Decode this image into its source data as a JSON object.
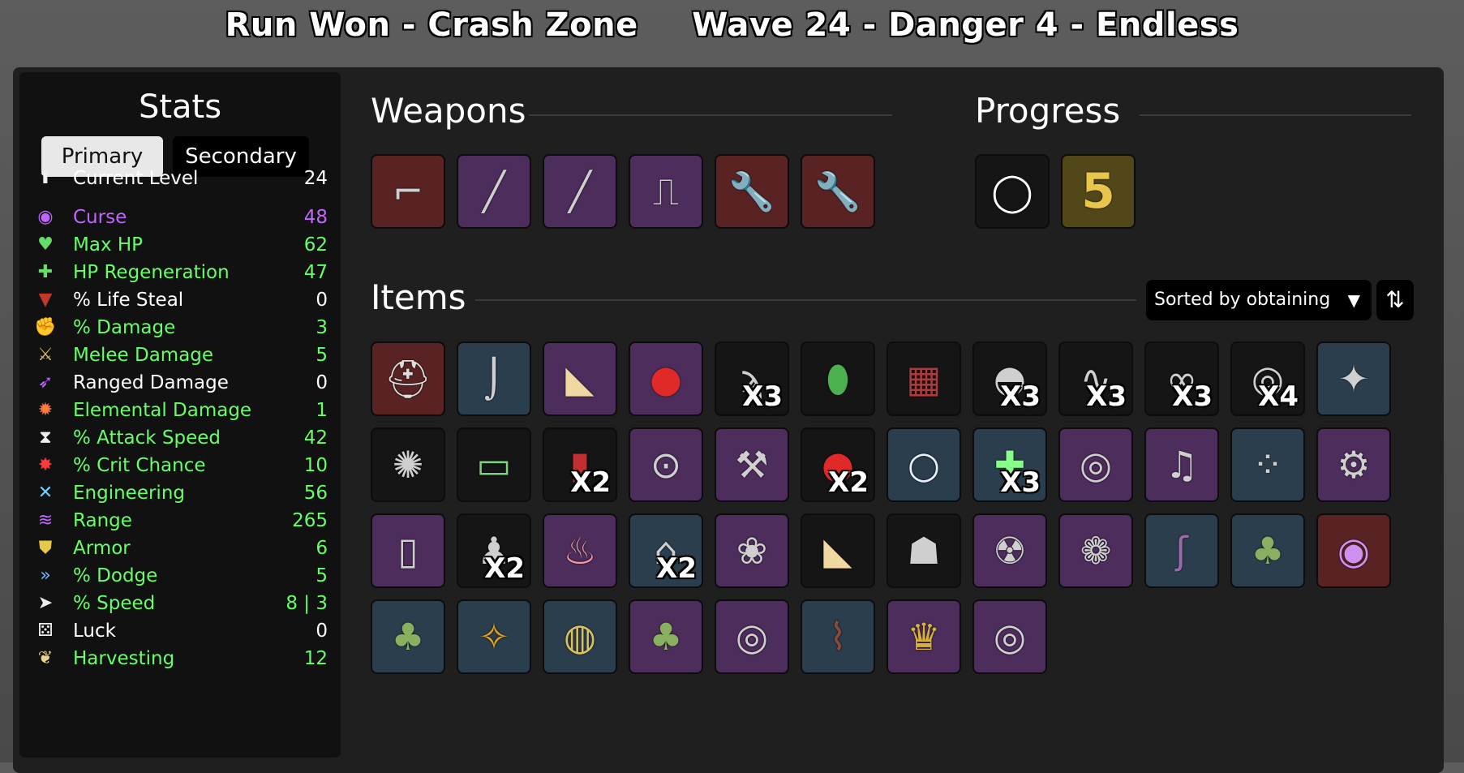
{
  "header": {
    "run": "Run Won - Crash Zone",
    "wave": "Wave 24 - Danger 4 - Endless"
  },
  "stats": {
    "title": "Stats",
    "tabs": {
      "primary": "Primary",
      "secondary": "Secondary"
    },
    "rows": [
      {
        "label": "Current Level",
        "value": "24",
        "color": "#ffffff",
        "icon": "level-up-icon"
      },
      {
        "label": "Curse",
        "value": "48",
        "color": "#c065ff",
        "icon": "curse-eye-icon"
      },
      {
        "label": "Max HP",
        "value": "62",
        "color": "#66ff66",
        "icon": "heart-icon"
      },
      {
        "label": "HP Regeneration",
        "value": "47",
        "color": "#66ff66",
        "icon": "heart-plus-icon"
      },
      {
        "label": "% Life Steal",
        "value": "0",
        "color": "#ffffff",
        "icon": "fangs-icon"
      },
      {
        "label": "% Damage",
        "value": "3",
        "color": "#66ff66",
        "icon": "muscle-icon"
      },
      {
        "label": "Melee Damage",
        "value": "5",
        "color": "#66ff66",
        "icon": "sword-icon"
      },
      {
        "label": "Ranged Damage",
        "value": "0",
        "color": "#ffffff",
        "icon": "bow-icon"
      },
      {
        "label": "Elemental Damage",
        "value": "1",
        "color": "#66ff66",
        "icon": "flame-icon"
      },
      {
        "label": "% Attack Speed",
        "value": "42",
        "color": "#66ff66",
        "icon": "hourglass-icon"
      },
      {
        "label": "% Crit Chance",
        "value": "10",
        "color": "#66ff66",
        "icon": "crit-burst-icon"
      },
      {
        "label": "Engineering",
        "value": "56",
        "color": "#66ff66",
        "icon": "crossed-tools-icon"
      },
      {
        "label": "Range",
        "value": "265",
        "color": "#66ff66",
        "icon": "range-waves-icon"
      },
      {
        "label": "Armor",
        "value": "6",
        "color": "#66ff66",
        "icon": "shield-icon"
      },
      {
        "label": "% Dodge",
        "value": "5",
        "color": "#66ff66",
        "icon": "dash-icon"
      },
      {
        "label": "% Speed",
        "value": "8 | 3",
        "color": "#66ff66",
        "icon": "boot-icon"
      },
      {
        "label": "Luck",
        "value": "0",
        "color": "#ffffff",
        "icon": "dice-icon"
      },
      {
        "label": "Harvesting",
        "value": "12",
        "color": "#66ff66",
        "icon": "wheat-icon"
      }
    ]
  },
  "weapons": {
    "title": "Weapons",
    "slots": [
      {
        "icon": "revolver-icon",
        "tier": "red"
      },
      {
        "icon": "screwdriver-icon",
        "tier": "purple"
      },
      {
        "icon": "screwdriver-icon",
        "tier": "purple"
      },
      {
        "icon": "ray-gun-icon",
        "tier": "purple"
      },
      {
        "icon": "wrench-icon",
        "tier": "red"
      },
      {
        "icon": "wrench-icon",
        "tier": "red"
      }
    ]
  },
  "progress": {
    "title": "Progress",
    "slots": [
      {
        "icon": "egg-character-icon",
        "tier": "black",
        "text": ""
      },
      {
        "icon": "danger-number-icon",
        "tier": "gold",
        "text": "5"
      }
    ]
  },
  "items": {
    "title": "Items",
    "sort_label": "Sorted by obtaining",
    "sort_arrow": "▼",
    "sort_direction": "⇅",
    "slots": [
      {
        "icon": "helmet-icon",
        "tier": "red",
        "qty": ""
      },
      {
        "icon": "fishing-hook-icon",
        "tier": "blue",
        "qty": ""
      },
      {
        "icon": "cheese-icon",
        "tier": "purple",
        "qty": ""
      },
      {
        "icon": "boxing-glove-icon",
        "tier": "purple",
        "qty": ""
      },
      {
        "icon": "tentacle-sprout-icon",
        "tier": "black",
        "qty": "X3"
      },
      {
        "icon": "alien-egg-icon",
        "tier": "black",
        "qty": ""
      },
      {
        "icon": "plaid-shirt-icon",
        "tier": "black",
        "qty": ""
      },
      {
        "icon": "mushroom-cap-icon",
        "tier": "black",
        "qty": "X3"
      },
      {
        "icon": "lizard-icon",
        "tier": "black",
        "qty": "X3"
      },
      {
        "icon": "glasses-icon",
        "tier": "black",
        "qty": "X3"
      },
      {
        "icon": "turret-icon",
        "tier": "black",
        "qty": "X4"
      },
      {
        "icon": "shard-burst-icon",
        "tier": "blue",
        "qty": ""
      },
      {
        "icon": "hedgehog-icon",
        "tier": "black",
        "qty": ""
      },
      {
        "icon": "cash-bill-icon",
        "tier": "black",
        "qty": ""
      },
      {
        "icon": "dynamite-icon",
        "tier": "black",
        "qty": "X2"
      },
      {
        "icon": "goggles-icon",
        "tier": "purple",
        "qty": ""
      },
      {
        "icon": "tools-bundle-icon",
        "tier": "purple",
        "qty": ""
      },
      {
        "icon": "boxing-glove-icon",
        "tier": "black",
        "qty": "X2"
      },
      {
        "icon": "crystal-ball-icon",
        "tier": "blue",
        "qty": ""
      },
      {
        "icon": "medic-turret-icon",
        "tier": "blue",
        "qty": "X3"
      },
      {
        "icon": "turret-icon",
        "tier": "purple",
        "qty": ""
      },
      {
        "icon": "bell-icon",
        "tier": "purple",
        "qty": ""
      },
      {
        "icon": "spotted-dice-icon",
        "tier": "blue",
        "qty": ""
      },
      {
        "icon": "gear-icon",
        "tier": "purple",
        "qty": ""
      },
      {
        "icon": "bottle-icon",
        "tier": "purple",
        "qty": ""
      },
      {
        "icon": "penguin-icon",
        "tier": "black",
        "qty": "X2"
      },
      {
        "icon": "piggy-bank-icon",
        "tier": "purple",
        "qty": ""
      },
      {
        "icon": "hood-icon",
        "tier": "blue",
        "qty": "X2"
      },
      {
        "icon": "brain-icon",
        "tier": "purple",
        "qty": ""
      },
      {
        "icon": "cheese-icon",
        "tier": "black",
        "qty": ""
      },
      {
        "icon": "ghost-icon",
        "tier": "black",
        "qty": ""
      },
      {
        "icon": "robot-bug-icon",
        "tier": "purple",
        "qty": ""
      },
      {
        "icon": "tardigrade-icon",
        "tier": "purple",
        "qty": ""
      },
      {
        "icon": "tentacle-icon",
        "tier": "blue",
        "qty": ""
      },
      {
        "icon": "garden-planter-icon",
        "tier": "blue",
        "qty": ""
      },
      {
        "icon": "eyeball-icon",
        "tier": "red",
        "qty": ""
      },
      {
        "icon": "garden-planter-icon",
        "tier": "blue",
        "qty": ""
      },
      {
        "icon": "wasp-icon",
        "tier": "blue",
        "qty": ""
      },
      {
        "icon": "golden-orb-icon",
        "tier": "blue",
        "qty": ""
      },
      {
        "icon": "garden-planter-icon",
        "tier": "purple",
        "qty": ""
      },
      {
        "icon": "turret-icon",
        "tier": "purple",
        "qty": ""
      },
      {
        "icon": "wood-plank-icon",
        "tier": "blue",
        "qty": ""
      },
      {
        "icon": "crown-icon",
        "tier": "purple",
        "qty": ""
      },
      {
        "icon": "turret-icon",
        "tier": "purple",
        "qty": ""
      }
    ]
  }
}
